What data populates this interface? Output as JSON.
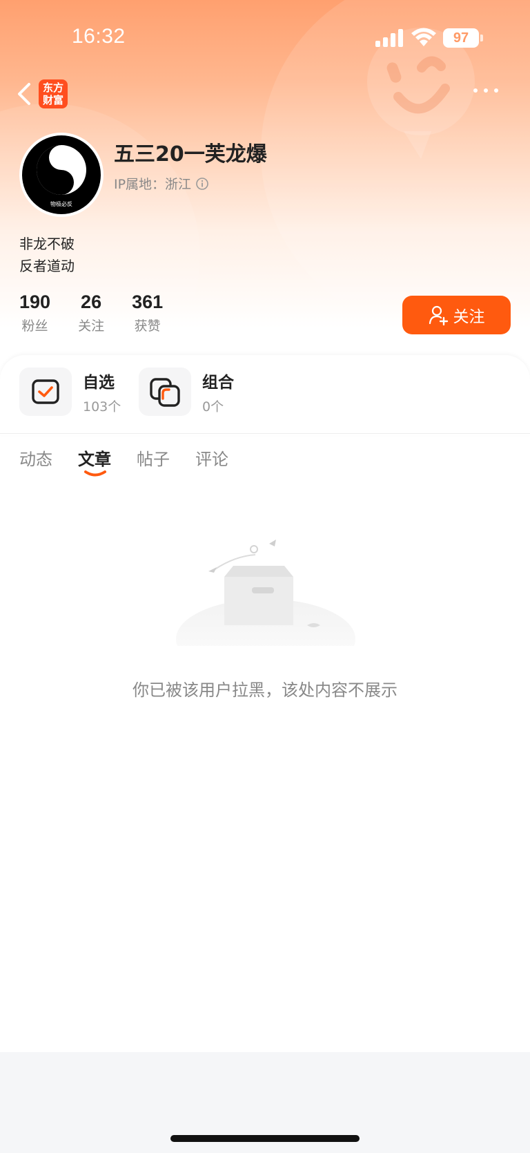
{
  "status_bar": {
    "time": "16:32",
    "battery": "97"
  },
  "nav": {
    "logo_line1": "东方",
    "logo_line2": "财富"
  },
  "profile": {
    "username": "五三20一芙龙爆",
    "ip_location": "IP属地：浙江",
    "bio_line1": "非龙不破",
    "bio_line2": "反者道动",
    "avatar_caption": "物极必反"
  },
  "stats": [
    {
      "value": "190",
      "label": "粉丝"
    },
    {
      "value": "26",
      "label": "关注"
    },
    {
      "value": "361",
      "label": "获赞"
    }
  ],
  "follow_button": {
    "label": "关注"
  },
  "card": {
    "watchlist": {
      "title": "自选",
      "count": "103个"
    },
    "portfolio": {
      "title": "组合",
      "count": "0个"
    }
  },
  "tabs": [
    {
      "label": "动态"
    },
    {
      "label": "文章",
      "active": true
    },
    {
      "label": "帖子"
    },
    {
      "label": "评论"
    }
  ],
  "empty_state": {
    "message": "你已被该用户拉黑，该处内容不展示"
  },
  "colors": {
    "accent": "#ff5a0f",
    "hero_top": "#ffa06f"
  }
}
